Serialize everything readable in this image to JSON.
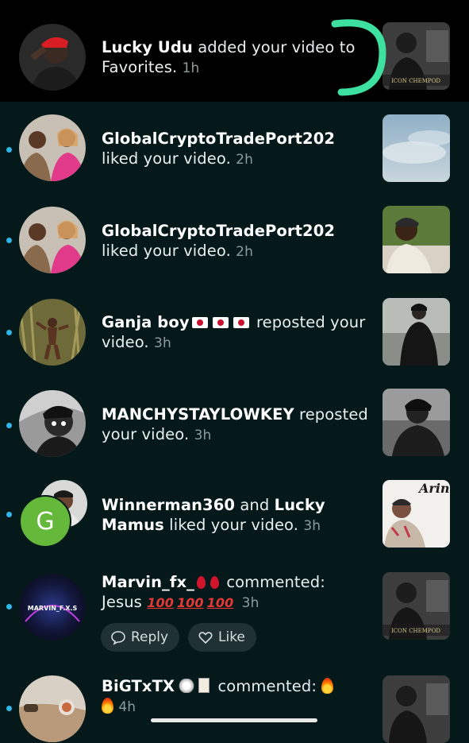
{
  "notifications": [
    {
      "name": "Lucky Udu",
      "text": " added your video to Favorites. ",
      "time": "1h",
      "thumb_caption": "ICON CHEMPOD"
    },
    {
      "name": "GlobalCryptoTradePort202",
      "text": " liked your video. ",
      "time": "2h"
    },
    {
      "name": "GlobalCryptoTradePort202",
      "text": " liked your video. ",
      "time": "2h"
    },
    {
      "name": "Ganja boy",
      "text": " reposted your video. ",
      "time": "3h"
    },
    {
      "name": "MANCHYSTAYLOWKEY",
      "text": " reposted your video. ",
      "time": "3h"
    },
    {
      "name": "Winnerman360",
      "and": " and ",
      "name2": "Lucky Mamus",
      "text": " liked your video. ",
      "time": "3h",
      "avatar_letter": "G",
      "thumb_text": "Arine"
    },
    {
      "name": "Marvin_fx_",
      "text": " commented: ",
      "comment": "Jesus ",
      "time": "3h",
      "avatar_label": "MARVIN_F.X.S",
      "thumb_caption": "ICON CHEMPOD"
    },
    {
      "name": "BiGTxTX",
      "text": " commented: ",
      "time": "4h"
    }
  ],
  "actions": {
    "reply": "Reply",
    "like": "Like"
  },
  "colors": {
    "unread_dot": "#2fb6ea",
    "highlight_stroke": "#3ee0a0",
    "background": "#05191b"
  }
}
